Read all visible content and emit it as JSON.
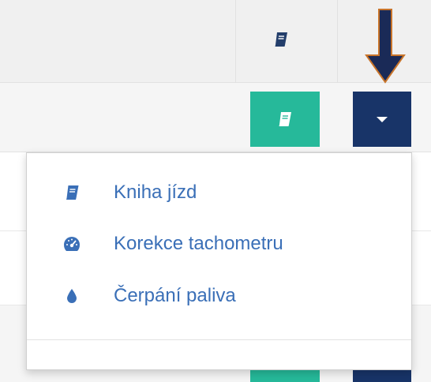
{
  "menu": {
    "items": [
      {
        "label": "Kniha jízd",
        "icon": "book-icon"
      },
      {
        "label": "Korekce tachometru",
        "icon": "tachometer-icon"
      },
      {
        "label": "Čerpání paliva",
        "icon": "fuel-drop-icon"
      }
    ]
  },
  "toolbar": {
    "logbook_button_icon": "book-icon",
    "dropdown_toggle_icon": "caret-down-icon"
  },
  "colors": {
    "accent_green": "#26b99a",
    "accent_navy": "#183468",
    "link_blue": "#3a6fb7",
    "annotation_arrow": "#1a2a57",
    "annotation_arrow_outline": "#c8742a"
  }
}
